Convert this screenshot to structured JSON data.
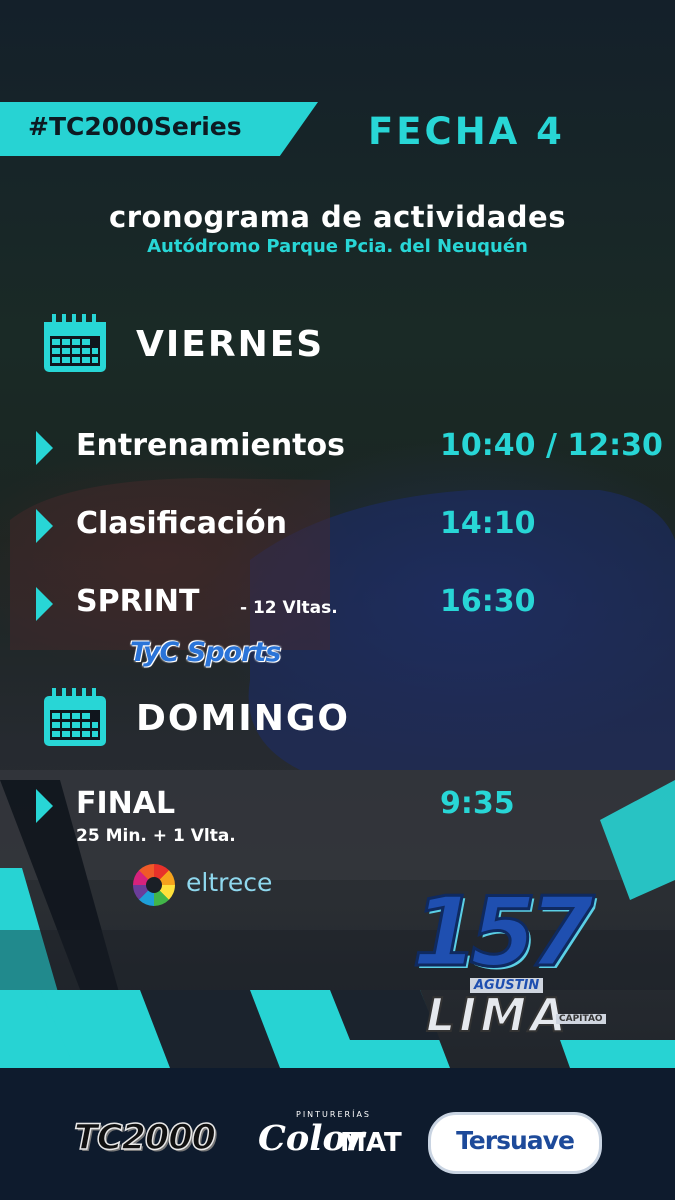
{
  "hashtag": "#TC2000Series",
  "fecha": "FECHA 4",
  "title": "cronograma de actividades",
  "subtitle": "Autódromo Parque Pcia. del Neuquén",
  "days": [
    {
      "name": "VIERNES",
      "events": [
        {
          "name": "Entrenamientos",
          "time": "10:40 / 12:30"
        },
        {
          "name": "Clasificación",
          "time": "14:10"
        },
        {
          "name": "SPRINT",
          "detail": "- 12 Vltas.",
          "time": "16:30",
          "broadcaster": "TyC Sports"
        }
      ]
    },
    {
      "name": "DOMINGO",
      "events": [
        {
          "name": "FINAL",
          "detail": "25 Min. + 1 Vlta.",
          "time": "9:35",
          "broadcaster": "eltrece"
        }
      ]
    }
  ],
  "driver_logo": {
    "number": "157",
    "first_name": "AGUSTIN",
    "last_name": "LIMA",
    "tag": "CAPITÃO"
  },
  "sponsors": {
    "tc2000": "TC2000",
    "colormat_top": "PINTURERÍAS",
    "colormat": "Color",
    "colormat_mat": "MAT",
    "tersuave": "Tersuave"
  },
  "colors": {
    "accent": "#28d6d6",
    "navy": "#0e1b2d",
    "background": "#1a1f26"
  },
  "icons": [
    "calendar-icon",
    "play-arrow-icon",
    "eltrece-sun-icon"
  ]
}
